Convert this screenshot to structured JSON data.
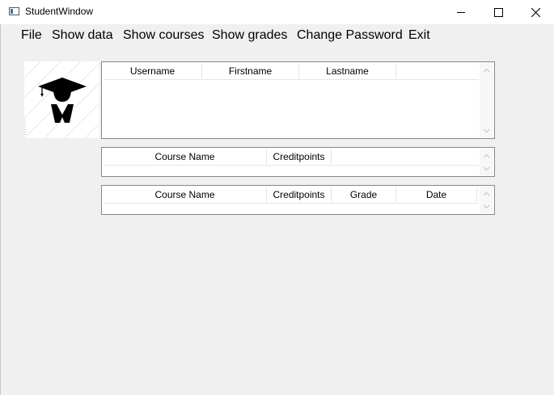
{
  "window": {
    "title": "StudentWindow",
    "icon": "app-window-icon",
    "controls": [
      "minimize-icon",
      "maximize-icon",
      "close-icon"
    ]
  },
  "menu": {
    "items": [
      "File",
      "Show data",
      "Show courses",
      "Show grades",
      "Change Password",
      "Exit"
    ]
  },
  "avatar": {
    "icon": "graduate-icon"
  },
  "user_grid": {
    "columns": [
      "Username",
      "Firstname",
      "Lastname"
    ]
  },
  "courses_grid": {
    "columns": [
      "Course Name",
      "Creditpoints"
    ]
  },
  "grades_grid": {
    "columns": [
      "Course Name",
      "Creditpoints",
      "Grade",
      "Date"
    ]
  },
  "colors": {
    "titlebar": "#ffffff",
    "background": "#f0f0f0",
    "grid_border": "#828790",
    "scroll_arrow": "#c2c2c2"
  }
}
